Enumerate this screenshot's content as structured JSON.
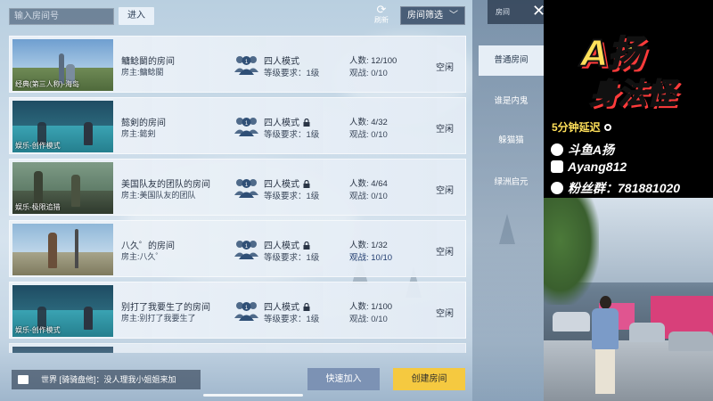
{
  "top": {
    "room_input_placeholder": "输入房间号",
    "enter_label": "进入",
    "refresh_label": "刷新",
    "filter_label": "房间筛选"
  },
  "rooms": [
    {
      "name": "鳙鲶鬭的房间",
      "owner": "房主:鳙鲶鬭",
      "tag": "经典(第三人称)-海岛",
      "mode": "四人模式",
      "locked": false,
      "level": "等级要求：1级",
      "players": "人数: 12/100",
      "watch": "观战: 0/10",
      "status": "空闲"
    },
    {
      "name": "懿剣的房间",
      "owner": "房主:懿剣",
      "tag": "娱乐-创作模式",
      "mode": "四人模式",
      "locked": true,
      "level": "等级要求：1级",
      "players": "人数: 4/32",
      "watch": "观战: 0/10",
      "status": "空闲"
    },
    {
      "name": "美国队友的团队的房间",
      "owner": "房主:美国队友的团队",
      "tag": "娱乐-极限追猎",
      "mode": "四人模式",
      "locked": true,
      "level": "等级要求：1级",
      "players": "人数: 4/64",
      "watch": "观战: 0/10",
      "status": "空闲"
    },
    {
      "name": "八久゜的房间",
      "owner": "房主:八久゜",
      "tag": "",
      "mode": "四人模式",
      "locked": true,
      "level": "等级要求：1级",
      "players": "人数: 1/32",
      "watch": "观战: 10/10",
      "status": "空闲"
    },
    {
      "name": "别打了我要生了的房间",
      "owner": "房主:别打了我要生了",
      "tag": "娱乐-创作模式",
      "mode": "四人模式",
      "locked": true,
      "level": "等级要求：1级",
      "players": "人数: 1/100",
      "watch": "观战: 0/10",
      "status": "空闲"
    }
  ],
  "side": {
    "header_label": "房间",
    "tabs": [
      "普通房间",
      "谁是内鬼",
      "躲猫猫",
      "绿洲启元"
    ],
    "active_tab": 0
  },
  "bottom": {
    "chat_text": "世界 [骑骑盘他]：没人理我小姐姐来加",
    "quick_join": "快速加入",
    "create_room": "创建房间"
  },
  "overlay": {
    "logo_main": "A扬",
    "logo_sub": "身法怪",
    "delay_text": "5分钟延迟",
    "douyu": "斗鱼A扬",
    "douyin": "Ayang812",
    "fans": "粉丝群：781881020"
  },
  "colors": {
    "create_button": "#f5c940",
    "quick_join_button": "#7c92b4",
    "logo_yellow": "#ffe05a",
    "logo_shadow": "#ff3b3b"
  }
}
